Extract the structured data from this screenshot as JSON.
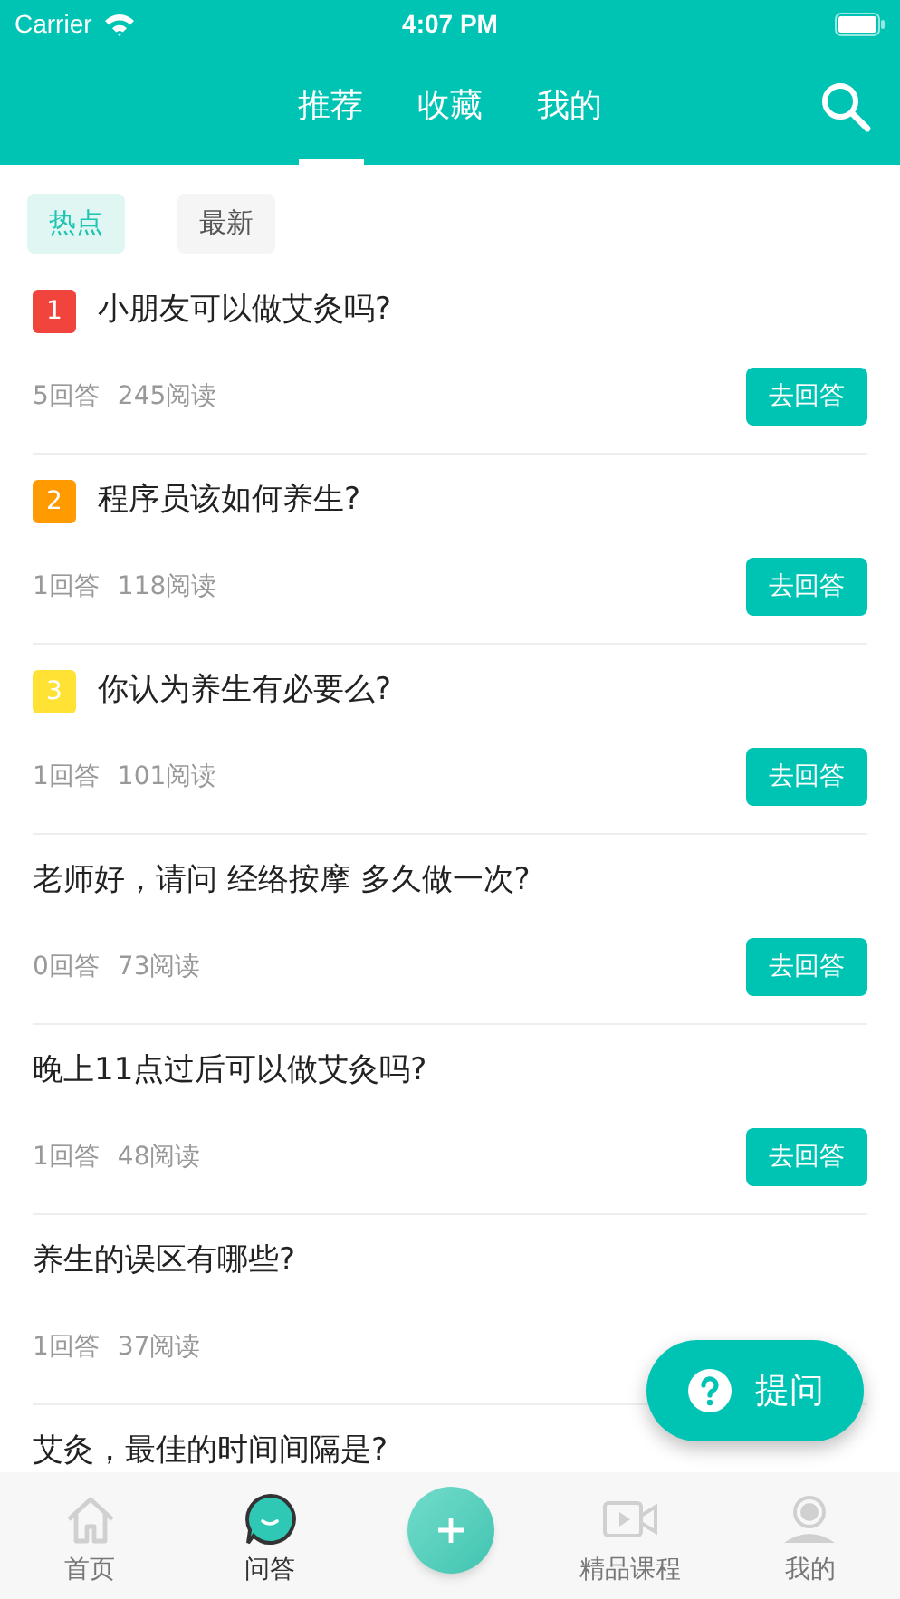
{
  "status_bar": {
    "carrier": "Carrier",
    "time": "4:07 PM"
  },
  "header_tabs": [
    {
      "label": "推荐",
      "selected": true
    },
    {
      "label": "收藏",
      "selected": false
    },
    {
      "label": "我的",
      "selected": false
    }
  ],
  "filters": [
    {
      "label": "热点",
      "selected": true
    },
    {
      "label": "最新",
      "selected": false
    }
  ],
  "questions": [
    {
      "rank": "1",
      "color": "#f0443c",
      "title": "小朋友可以做艾灸吗?",
      "answers": "5回答",
      "reads": "245阅读",
      "button": "去回答"
    },
    {
      "rank": "2",
      "color": "#ff9a00",
      "title": "程序员该如何养生?",
      "answers": "1回答",
      "reads": "118阅读",
      "button": "去回答"
    },
    {
      "rank": "3",
      "color": "#ffe234",
      "title": "你认为养生有必要么?",
      "answers": "1回答",
      "reads": "101阅读",
      "button": "去回答"
    },
    {
      "title": "老师好，请问 经络按摩 多久做一次?",
      "answers": "0回答",
      "reads": "73阅读",
      "button": "去回答"
    },
    {
      "title": "晚上11点过后可以做艾灸吗?",
      "answers": "1回答",
      "reads": "48阅读",
      "button": "去回答"
    },
    {
      "title": "养生的误区有哪些?",
      "answers": "1回答",
      "reads": "37阅读"
    },
    {
      "title": "艾灸，最佳的时间间隔是?"
    }
  ],
  "ask_button": {
    "label": "提问"
  },
  "tab_bar": [
    {
      "kind": "home",
      "label": "首页",
      "selected": false
    },
    {
      "kind": "qa",
      "label": "问答",
      "selected": true
    },
    {
      "kind": "add"
    },
    {
      "kind": "video",
      "label": "精品课程",
      "selected": false
    },
    {
      "kind": "profile",
      "label": "我的",
      "selected": false
    }
  ]
}
